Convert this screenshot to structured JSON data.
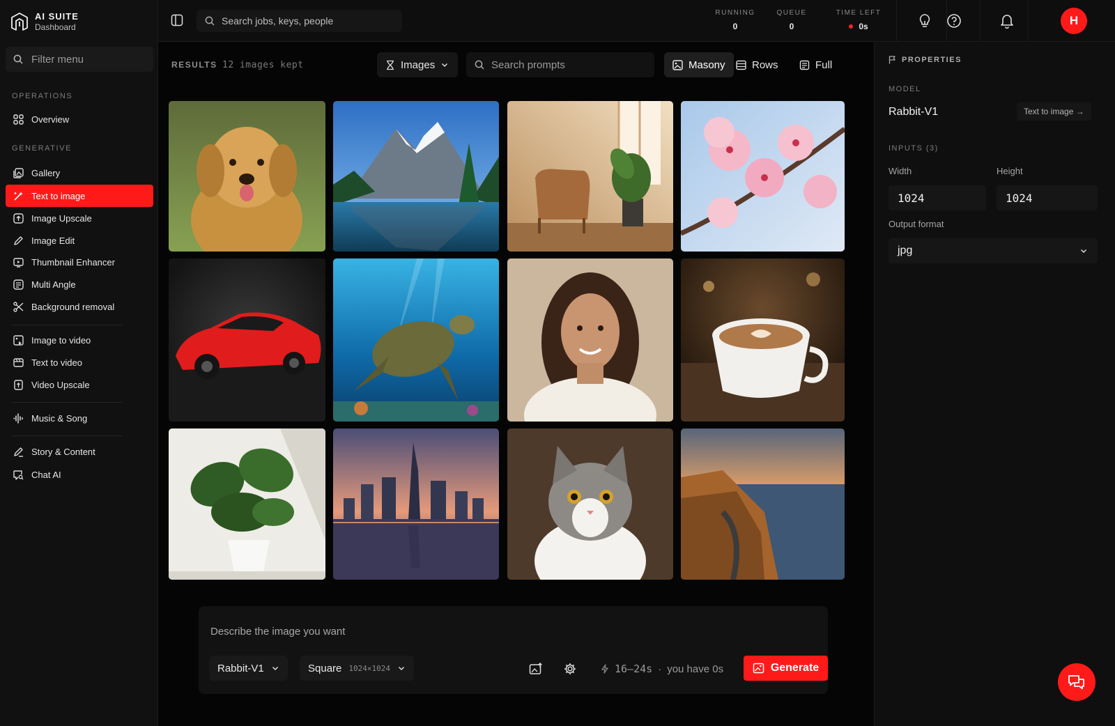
{
  "brand": {
    "name": "AI SUITE",
    "subtitle": "Dashboard"
  },
  "sidebar": {
    "filter_placeholder": "Filter menu",
    "sections": {
      "operations": "OPERATIONS",
      "generative": "GENERATIVE"
    },
    "items": [
      {
        "label": "Overview",
        "icon": "grid-icon"
      },
      {
        "label": "Gallery",
        "icon": "gallery-icon"
      },
      {
        "label": "Text to image",
        "icon": "wand-icon",
        "active": true
      },
      {
        "label": "Image Upscale",
        "icon": "upscale-icon"
      },
      {
        "label": "Image Edit",
        "icon": "pen-icon"
      },
      {
        "label": "Thumbnail Enhancer",
        "icon": "thumbnail-icon"
      },
      {
        "label": "Multi Angle",
        "icon": "cube-icon"
      },
      {
        "label": "Background removal",
        "icon": "scissors-icon"
      },
      {
        "label": "Image to video",
        "icon": "image-video-icon"
      },
      {
        "label": "Text to video",
        "icon": "text-video-icon"
      },
      {
        "label": "Video Upscale",
        "icon": "video-upscale-icon"
      },
      {
        "label": "Music & Song",
        "icon": "waveform-icon"
      },
      {
        "label": "Story & Content",
        "icon": "story-pen-icon"
      },
      {
        "label": "Chat AI",
        "icon": "chat-search-icon"
      }
    ]
  },
  "topbar": {
    "search_placeholder": "Search jobs, keys, people",
    "stats": [
      {
        "label": "RUNNING",
        "value": "0"
      },
      {
        "label": "QUEUE",
        "value": "0"
      },
      {
        "label": "TIME LEFT",
        "value": "0s"
      }
    ],
    "avatar_initial": "H"
  },
  "toolbar": {
    "results_label": "RESULTS",
    "results_count": "12 images kept",
    "filter_label": "Images",
    "search_placeholder": "Search prompts",
    "views": [
      "Masony",
      "Rows",
      "Full"
    ],
    "active_view": "Masony"
  },
  "gallery": {
    "images": [
      "golden retriever",
      "mountain lake",
      "armchair with plant",
      "cherry blossom",
      "red sports car",
      "sea turtle",
      "smiling woman",
      "latte art",
      "monstera plant",
      "city skyline at dusk",
      "tabby cat",
      "coastal road sunset"
    ]
  },
  "prompt": {
    "placeholder": "Describe the image you want",
    "model": "Rabbit-V1",
    "aspect": "Square",
    "aspect_size": "1024×1024",
    "eta": "16–24s",
    "balance_separator": "·",
    "balance": "you have 0s",
    "generate_label": "Generate"
  },
  "properties": {
    "title": "PROPERTIES",
    "model_label": "MODEL",
    "model_name": "Rabbit-V1",
    "model_link": "Text to image →",
    "inputs_label": "INPUTS (3)",
    "width_label": "Width",
    "width_value": "1024",
    "height_label": "Height",
    "height_value": "1024",
    "output_label": "Output format",
    "output_value": "jpg"
  },
  "colors": {
    "accent": "#ff1a1a",
    "background": "#050505",
    "panel": "#111111"
  }
}
